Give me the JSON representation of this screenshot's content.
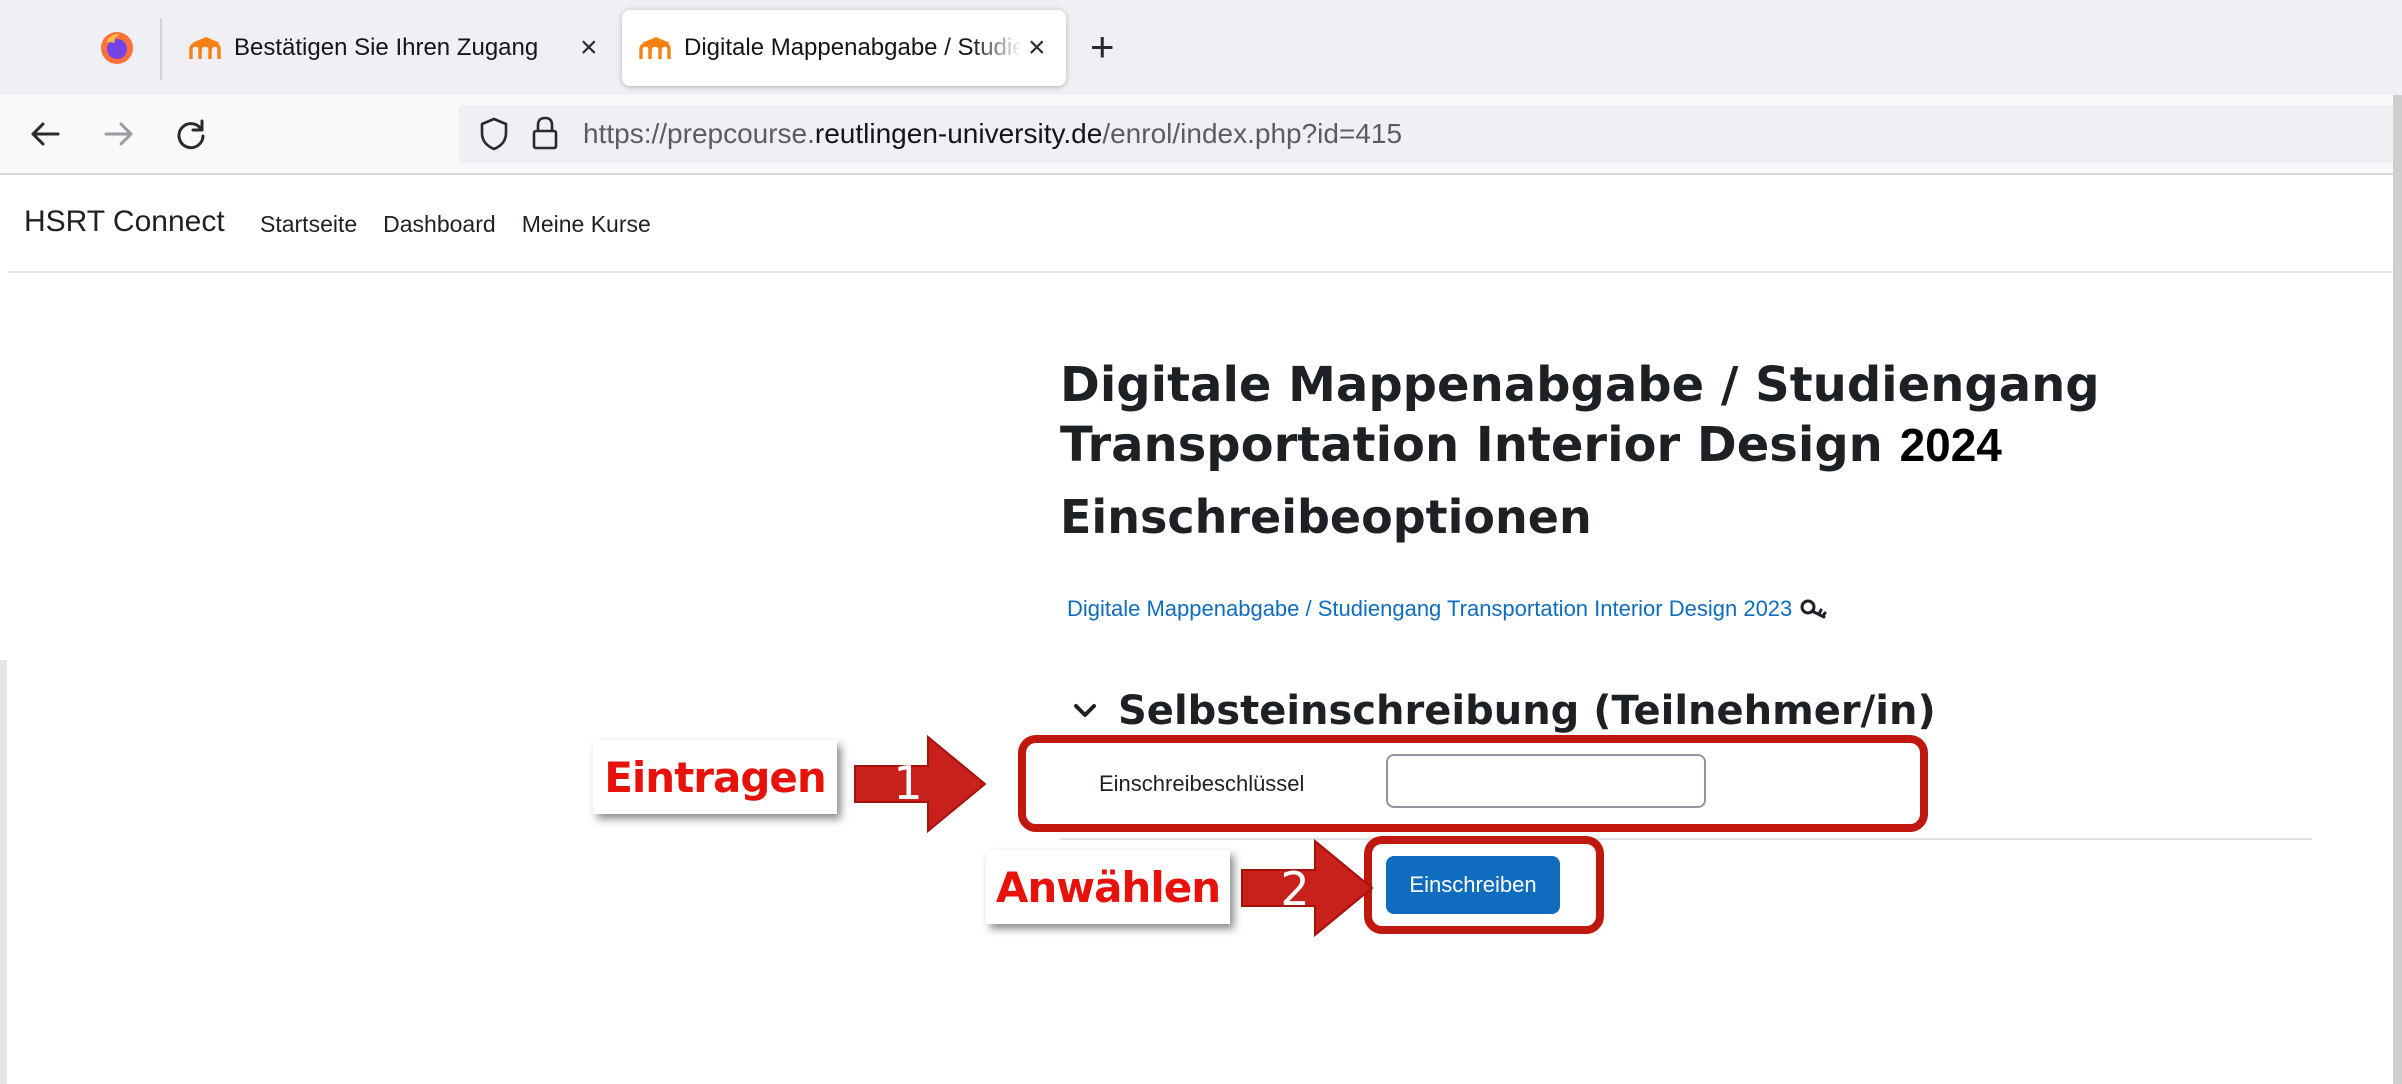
{
  "browser": {
    "tabs": [
      {
        "title": "Bestätigen Sie Ihren Zugang",
        "active": false
      },
      {
        "title": "Digitale Mappenabgabe / Studiengang Transportation Interior Design 2024",
        "active": true
      }
    ],
    "url": {
      "prefix": "https://prepcourse.",
      "domain": "reutlingen-university.de",
      "path": "/enrol/index.php?id=415"
    }
  },
  "site": {
    "brand": "HSRT Connect",
    "menu": [
      "Startseite",
      "Dashboard",
      "Meine Kurse"
    ]
  },
  "page": {
    "title_main": "Digitale Mappenabgabe / Studiengang Transportation Interior Design",
    "title_year": "2024",
    "subtitle": "Einschreibeoptionen",
    "course_link": "Digitale Mappenabgabe / Studiengang Transportation Interior Design 2023",
    "section_title": "Selbsteinschreibung (Teilnehmer/in)",
    "field_label": "Einschreibeschlüssel",
    "field_value": "",
    "button_label": "Einschreiben"
  },
  "annotations": {
    "step1_label": "Eintragen",
    "step1_number": "1",
    "step2_label": "Anwählen",
    "step2_number": "2",
    "highlight_color": "#c0170e",
    "label_color": "#e8120c"
  },
  "colors": {
    "moodle_blue": "#0f6cbf",
    "moodle_orange": "#f98012"
  }
}
